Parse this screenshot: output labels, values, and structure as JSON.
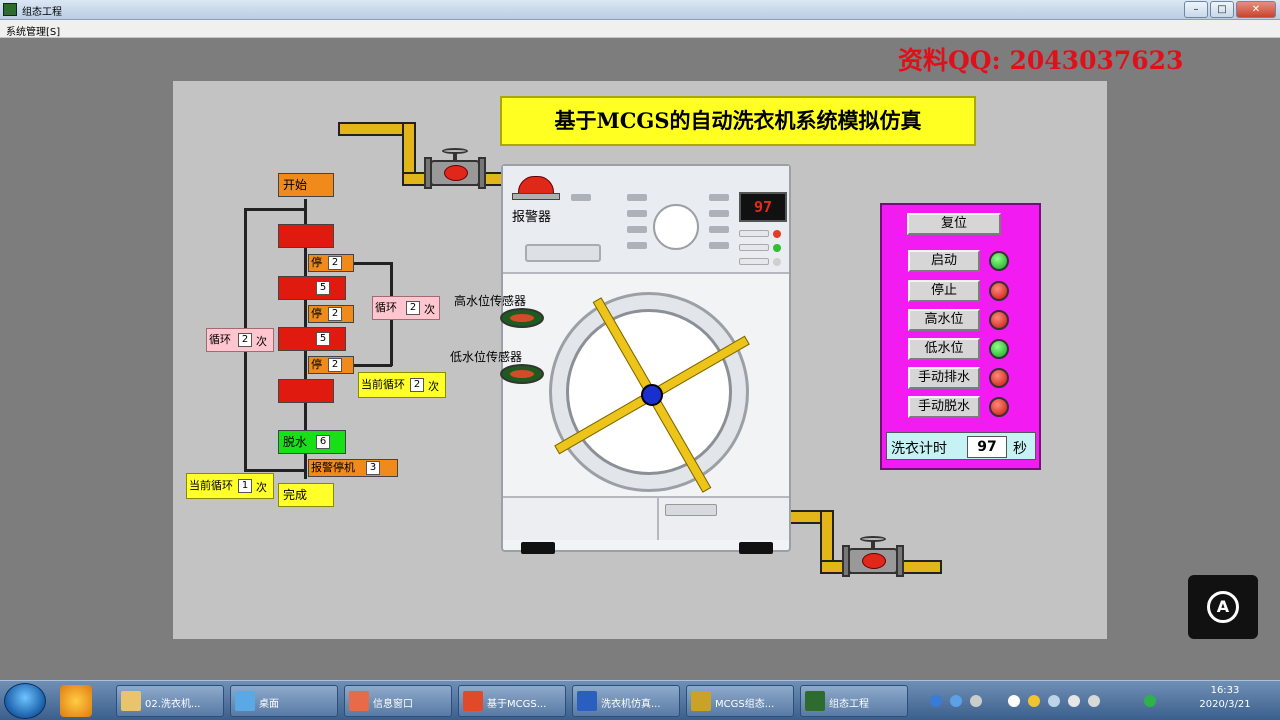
{
  "window": {
    "title": "组态工程",
    "buttons": [
      "–",
      "□",
      "✕"
    ]
  },
  "menu": {
    "item": "系统管理[S]"
  },
  "watermark": "资料QQ: 2043037623",
  "banner": {
    "title": "基于MCGS的自动洗衣机系统模拟仿真"
  },
  "washer": {
    "display": "97",
    "alarm_label": "报警器",
    "high_sensor": "高水位传感器",
    "low_sensor": "低水位传感器",
    "led_colors": [
      "#e53b2b",
      "#2fbf2f",
      "#cfcfcf"
    ]
  },
  "control_panel": {
    "reset": "复位",
    "rows": [
      {
        "label": "启动",
        "state": "on"
      },
      {
        "label": "停止",
        "state": "off"
      },
      {
        "label": "高水位",
        "state": "off"
      },
      {
        "label": "低水位",
        "state": "on"
      },
      {
        "label": "手动排水",
        "state": "off"
      },
      {
        "label": "手动脱水",
        "state": "off"
      }
    ],
    "timer_label": "洗衣计时",
    "timer_value": "97",
    "timer_unit": "秒"
  },
  "flow": {
    "start": "开始",
    "stop_short": "停",
    "done": "完成",
    "stop_values": [
      "2",
      "2",
      "2"
    ],
    "loop_values": [
      "5",
      "5"
    ],
    "inner_loop": {
      "label": "循环",
      "value": "2",
      "unit": "次"
    },
    "outer_loop": {
      "label": "循环",
      "value": "2",
      "unit": "次"
    },
    "current_inner": {
      "label": "当前循环",
      "value": "2",
      "unit": "次"
    },
    "current_outer": {
      "label": "当前循环",
      "value": "1",
      "unit": "次"
    },
    "spin": {
      "label": "脱水",
      "value": "6"
    },
    "alarm_stop": {
      "label": "报警停机",
      "value": "3"
    }
  },
  "taskbar": {
    "tasks": [
      {
        "label": "02.洗衣机...",
        "color": "#e9c46a"
      },
      {
        "label": "桌面",
        "color": "#5aa9e6"
      },
      {
        "label": "信息窗口",
        "color": "#e56b4a"
      },
      {
        "label": "基于MCGS...",
        "color": "#e04a2a"
      },
      {
        "label": "洗衣机仿真...",
        "color": "#2b5fbf"
      },
      {
        "label": "MCGS组态...",
        "color": "#c9a227"
      },
      {
        "label": "组态工程",
        "color": "#2e6b2f"
      }
    ],
    "time": "16:33",
    "date": "2020/3/21"
  }
}
